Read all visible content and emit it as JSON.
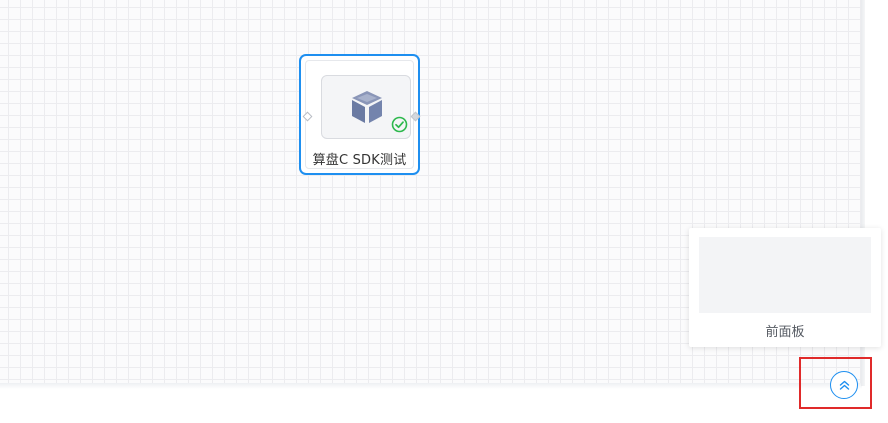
{
  "canvas": {
    "node": {
      "title": "算盘C SDK测试",
      "icon": "cube-icon",
      "status_icon": "check-circle-icon",
      "selected": true,
      "accent_color": "#1e8ff0",
      "status_color": "#2db84d"
    }
  },
  "panel": {
    "title": "前面板"
  },
  "toggle": {
    "icon": "double-chevron-up-icon",
    "highlight_color": "#e02a2a"
  }
}
